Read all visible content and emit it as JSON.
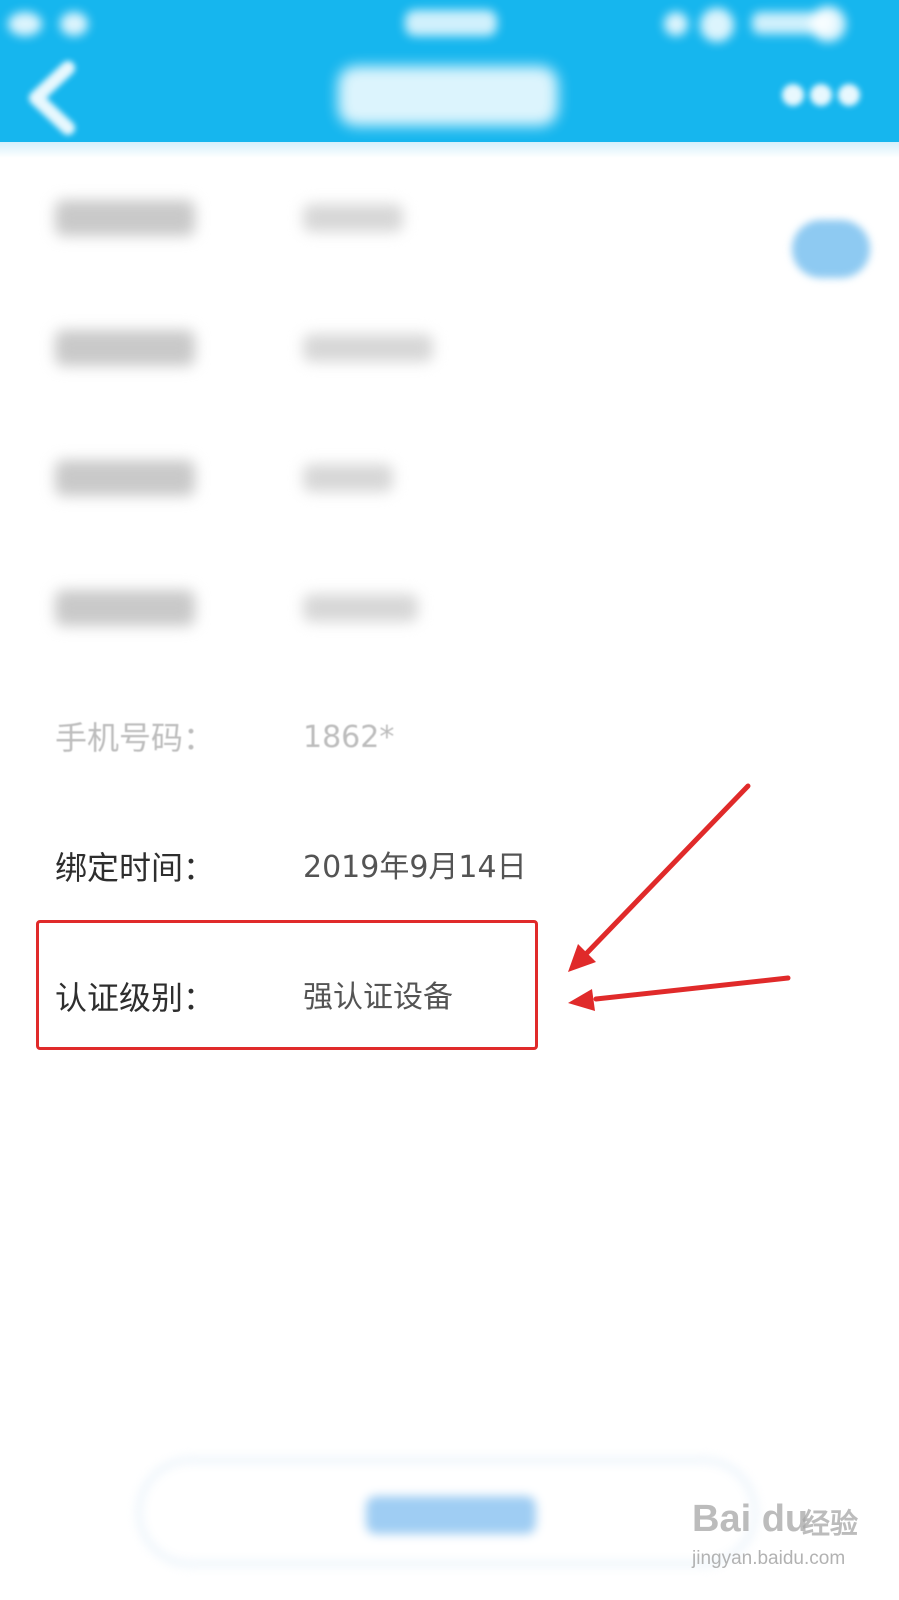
{
  "header": {
    "background_color": "#16b6ee",
    "back_icon": "chevron-left-icon",
    "more_icon": "more-dots-icon"
  },
  "rows": [
    {
      "label": "",
      "value": "",
      "state": "blurred"
    },
    {
      "label": "",
      "value": "",
      "state": "blurred"
    },
    {
      "label": "",
      "value": "",
      "state": "blurred"
    },
    {
      "label": "",
      "value": "",
      "state": "blurred"
    },
    {
      "label": "手机号码：",
      "value": "1862*",
      "state": "faded"
    },
    {
      "label": "绑定时间：",
      "value": "2019年9月14日",
      "state": "visible"
    },
    {
      "label": "认证级别：",
      "value": "强认证设备",
      "state": "visible"
    }
  ],
  "toggle_icon": "eye-icon",
  "annotation": {
    "box_color": "#e02a2a",
    "arrow_color": "#e02a2a"
  },
  "watermark": {
    "logo": "Bai du",
    "brand_cn": "经验",
    "url": "jingyan.baidu.com"
  }
}
